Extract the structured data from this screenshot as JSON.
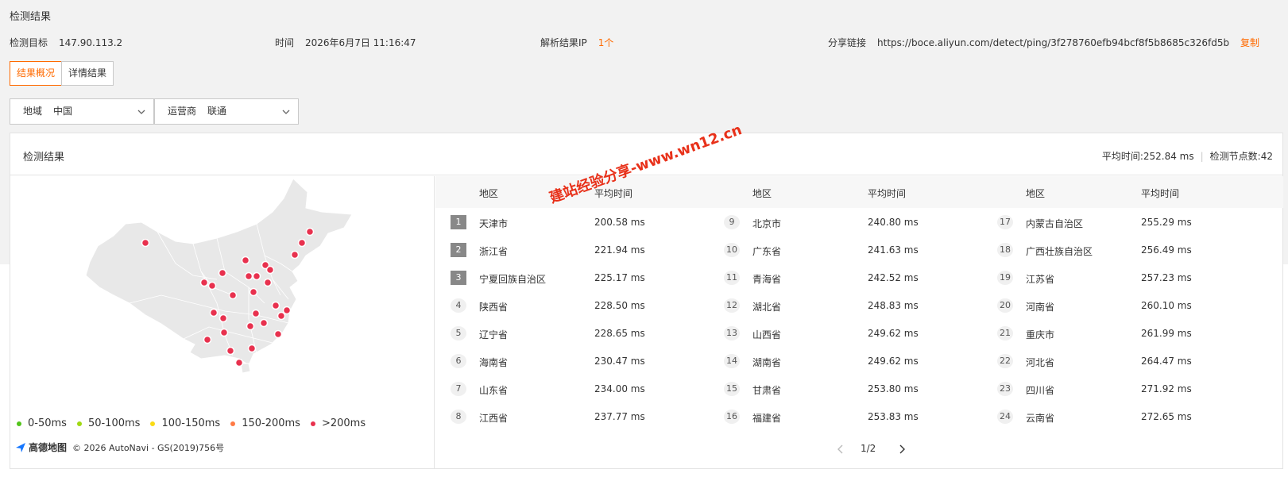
{
  "page_title": "检测结果",
  "info": {
    "target_label": "检测目标",
    "target_value": "147.90.113.2",
    "time_label": "时间",
    "time_value": "2026年6月7日 11:16:47",
    "ip_label": "解析结果IP",
    "ip_count": "1个",
    "share_label": "分享链接",
    "share_url": "https://boce.aliyun.com/detect/ping/3f278760efb94bcf8f5b8685c326fd5b",
    "copy_label": "复制"
  },
  "tabs": [
    {
      "label": "结果概况",
      "active": true
    },
    {
      "label": "详情结果",
      "active": false
    }
  ],
  "filters": {
    "region_label": "地域",
    "region_value": "中国",
    "isp_label": "运营商",
    "isp_value": "联通"
  },
  "card": {
    "title": "检测结果",
    "avg_time": "平均时间:252.84 ms",
    "node_count": "检测节点数:42"
  },
  "legend": [
    {
      "label": "0-50ms",
      "color": "#52c41a"
    },
    {
      "label": "50-100ms",
      "color": "#a0d911"
    },
    {
      "label": "100-150ms",
      "color": "#fadb14"
    },
    {
      "label": "150-200ms",
      "color": "#ff7a45"
    },
    {
      "label": ">200ms",
      "color": "#e8314e"
    }
  ],
  "attribution": {
    "brand": "高德地图",
    "text": "© 2026 AutoNavi - GS(2019)756号"
  },
  "table": {
    "headers": [
      "地区",
      "平均时间",
      "地区",
      "平均时间",
      "地区",
      "平均时间"
    ],
    "columns": [
      [
        {
          "rank": "1",
          "region": "天津市",
          "time": "200.58 ms"
        },
        {
          "rank": "2",
          "region": "浙江省",
          "time": "221.94 ms"
        },
        {
          "rank": "3",
          "region": "宁夏回族自治区",
          "time": "225.17 ms"
        },
        {
          "rank": "4",
          "region": "陕西省",
          "time": "228.50 ms"
        },
        {
          "rank": "5",
          "region": "辽宁省",
          "time": "228.65 ms"
        },
        {
          "rank": "6",
          "region": "海南省",
          "time": "230.47 ms"
        },
        {
          "rank": "7",
          "region": "山东省",
          "time": "234.00 ms"
        },
        {
          "rank": "8",
          "region": "江西省",
          "time": "237.77 ms"
        }
      ],
      [
        {
          "rank": "9",
          "region": "北京市",
          "time": "240.80 ms"
        },
        {
          "rank": "10",
          "region": "广东省",
          "time": "241.63 ms"
        },
        {
          "rank": "11",
          "region": "青海省",
          "time": "242.52 ms"
        },
        {
          "rank": "12",
          "region": "湖北省",
          "time": "248.83 ms"
        },
        {
          "rank": "13",
          "region": "山西省",
          "time": "249.62 ms"
        },
        {
          "rank": "14",
          "region": "湖南省",
          "time": "249.62 ms"
        },
        {
          "rank": "15",
          "region": "甘肃省",
          "time": "253.80 ms"
        },
        {
          "rank": "16",
          "region": "福建省",
          "time": "253.83 ms"
        }
      ],
      [
        {
          "rank": "17",
          "region": "内蒙古自治区",
          "time": "255.29 ms"
        },
        {
          "rank": "18",
          "region": "广西壮族自治区",
          "time": "256.49 ms"
        },
        {
          "rank": "19",
          "region": "江苏省",
          "time": "257.23 ms"
        },
        {
          "rank": "20",
          "region": "河南省",
          "time": "260.10 ms"
        },
        {
          "rank": "21",
          "region": "重庆市",
          "time": "261.99 ms"
        },
        {
          "rank": "22",
          "region": "河北省",
          "time": "264.47 ms"
        },
        {
          "rank": "23",
          "region": "四川省",
          "time": "271.92 ms"
        },
        {
          "rank": "24",
          "region": "云南省",
          "time": "272.65 ms"
        }
      ]
    ]
  },
  "pager": {
    "text": "1/2"
  },
  "watermark": "建站经验分享-www.wn12.cn",
  "colors": {
    "accent": "#ff6a00",
    "marker": "#e8314e",
    "watermark": "#e8311a"
  }
}
